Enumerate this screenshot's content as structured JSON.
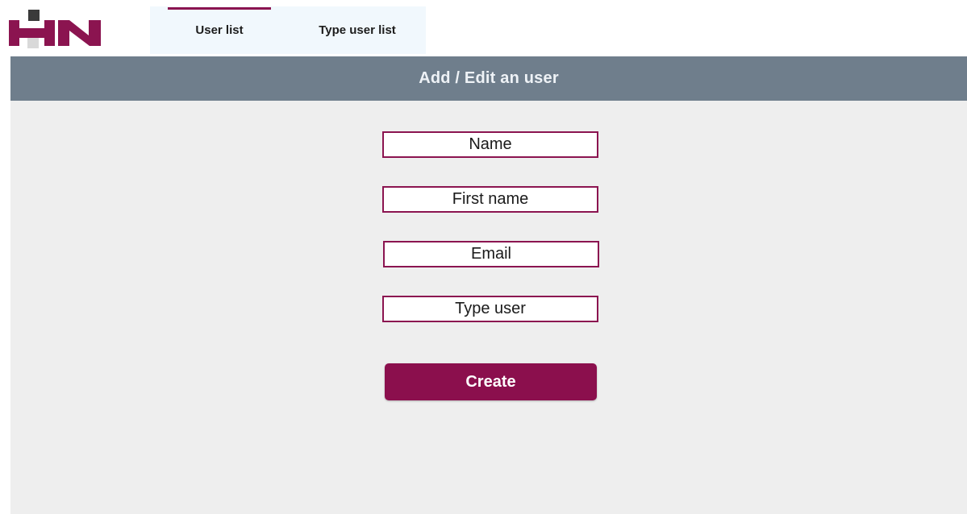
{
  "header": {
    "logo": {
      "name": "hn-logo",
      "text": "HN",
      "colors": {
        "letters": "#8b1450",
        "square_dark": "#3a3a3a",
        "square_light": "#d9d9d9"
      }
    },
    "tabs": [
      {
        "label": "User list",
        "active": true
      },
      {
        "label": "Type user list",
        "active": false
      }
    ]
  },
  "title_bar": {
    "title": "Add / Edit an user"
  },
  "form": {
    "fields": [
      {
        "placeholder": "Name",
        "value": ""
      },
      {
        "placeholder": "First name",
        "value": ""
      },
      {
        "placeholder": "Email",
        "value": ""
      },
      {
        "placeholder": "Type user",
        "value": ""
      }
    ],
    "submit_label": "Create"
  },
  "colors": {
    "accent": "#8b1450",
    "title_bar_bg": "#6f7e8c",
    "form_bg": "#eeeeee",
    "tabs_bg": "#f1f8fd"
  }
}
